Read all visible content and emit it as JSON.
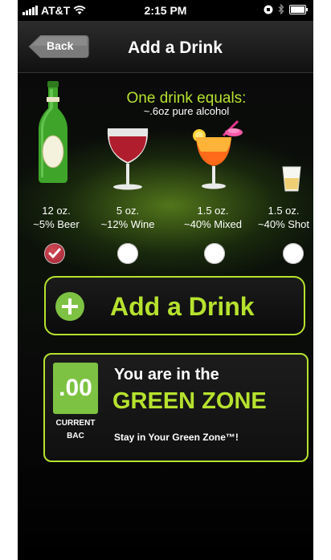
{
  "status_bar": {
    "carrier": "AT&T",
    "time": "2:15 PM"
  },
  "nav": {
    "back_label": "Back",
    "title": "Add a Drink"
  },
  "equivalence": {
    "title": "One drink equals:",
    "subtitle": "~.6oz pure alcohol"
  },
  "drinks": [
    {
      "size": "12 oz.",
      "desc": "~5% Beer",
      "icon": "beer-bottle-icon",
      "selected": true
    },
    {
      "size": "5 oz.",
      "desc": "~12% Wine",
      "icon": "wine-glass-icon",
      "selected": false
    },
    {
      "size": "1.5 oz.",
      "desc": "~40% Mixed",
      "icon": "cocktail-glass-icon",
      "selected": false
    },
    {
      "size": "1.5 oz.",
      "desc": "~40% Shot",
      "icon": "shot-glass-icon",
      "selected": false
    }
  ],
  "add_button": {
    "label": "Add a Drink"
  },
  "zone": {
    "bac_value": ".00",
    "bac_label_1": "CURRENT",
    "bac_label_2": "BAC",
    "line1": "You are in the",
    "line2": "GREEN ZONE",
    "tagline": "Stay in Your Green Zone™!"
  },
  "colors": {
    "accent_green": "#b6e22e",
    "bac_green": "#7dc242",
    "check_red": "#a32233"
  }
}
